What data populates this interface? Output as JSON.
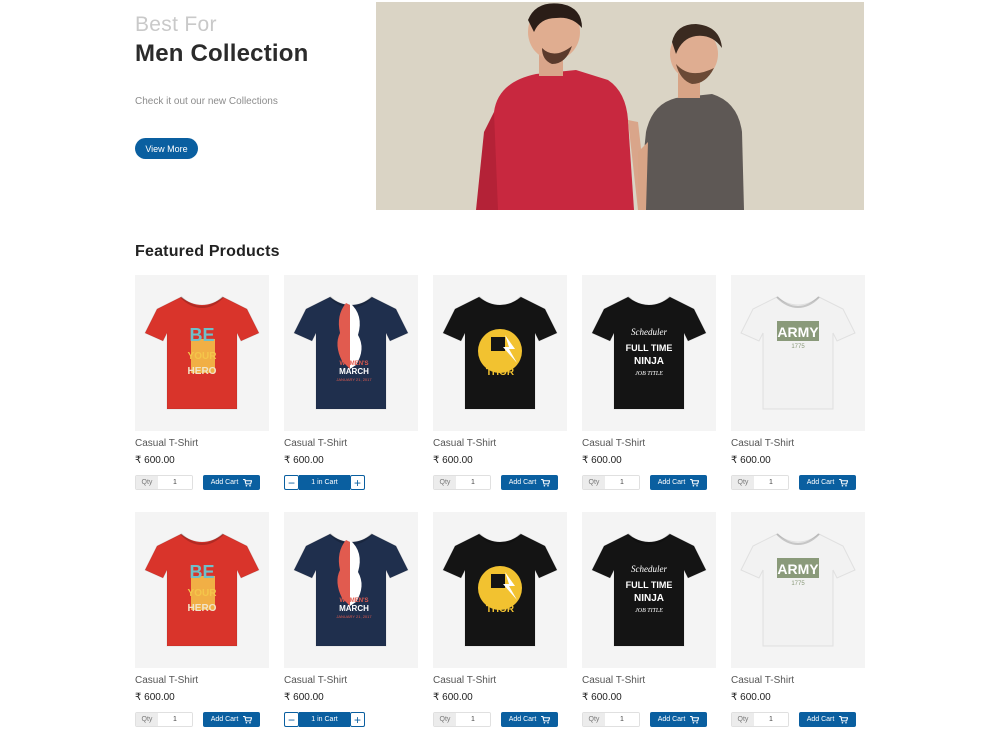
{
  "hero": {
    "kicker": "Best For",
    "title": "Men Collection",
    "subtitle": "Check it out our new Collections",
    "button_label": "View More"
  },
  "featured": {
    "title": "Featured Products"
  },
  "colors": {
    "accent": "#0a5fa0",
    "card_bg": "#f4f4f4"
  },
  "products": [
    {
      "name": "Casual T-Shirt",
      "price": "₹ 600.00",
      "qty_label": "Qty",
      "qty": "1",
      "button": "Add Cart",
      "shirt_color": "#d9342b",
      "design": "be-your-hero"
    },
    {
      "name": "Casual T-Shirt",
      "price": "₹ 600.00",
      "in_cart": "1 in Cart",
      "shirt_color": "#1f2f4d",
      "design": "womens-march"
    },
    {
      "name": "Casual T-Shirt",
      "price": "₹ 600.00",
      "qty_label": "Qty",
      "qty": "1",
      "button": "Add Cart",
      "shirt_color": "#141414",
      "design": "thor"
    },
    {
      "name": "Casual T-Shirt",
      "price": "₹ 600.00",
      "qty_label": "Qty",
      "qty": "1",
      "button": "Add Cart",
      "shirt_color": "#141414",
      "design": "scheduler-ninja"
    },
    {
      "name": "Casual T-Shirt",
      "price": "₹ 600.00",
      "qty_label": "Qty",
      "qty": "1",
      "button": "Add Cart",
      "shirt_color": "#f2f2f2",
      "design": "army"
    },
    {
      "name": "Casual T-Shirt",
      "price": "₹ 600.00",
      "qty_label": "Qty",
      "qty": "1",
      "button": "Add Cart",
      "shirt_color": "#d9342b",
      "design": "be-your-hero"
    },
    {
      "name": "Casual T-Shirt",
      "price": "₹ 600.00",
      "in_cart": "1 in Cart",
      "shirt_color": "#1f2f4d",
      "design": "womens-march"
    },
    {
      "name": "Casual T-Shirt",
      "price": "₹ 600.00",
      "qty_label": "Qty",
      "qty": "1",
      "button": "Add Cart",
      "shirt_color": "#141414",
      "design": "thor"
    },
    {
      "name": "Casual T-Shirt",
      "price": "₹ 600.00",
      "qty_label": "Qty",
      "qty": "1",
      "button": "Add Cart",
      "shirt_color": "#141414",
      "design": "scheduler-ninja"
    },
    {
      "name": "Casual T-Shirt",
      "price": "₹ 600.00",
      "qty_label": "Qty",
      "qty": "1",
      "button": "Add Cart",
      "shirt_color": "#f2f2f2",
      "design": "army"
    }
  ],
  "shirt_prints": {
    "be-your-hero": [
      "BE",
      "YOUR",
      "HERO"
    ],
    "womens-march": [
      "WOMEN'S",
      "MARCH",
      "JANUARY 21, 2017"
    ],
    "thor": [
      "THOR"
    ],
    "scheduler-ninja": [
      "Scheduler",
      "FULL TIME",
      "NINJA",
      "JOB TITLE"
    ],
    "army": [
      "ARMY",
      "1775"
    ]
  }
}
